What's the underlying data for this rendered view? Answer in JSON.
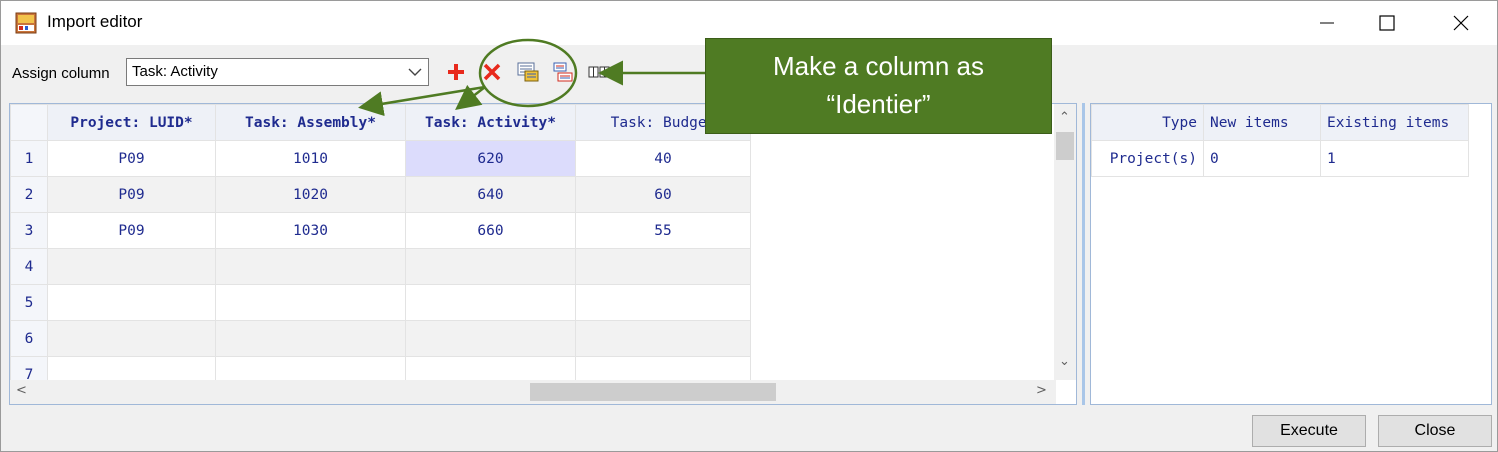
{
  "window": {
    "title": "Import editor",
    "app_icon": "mspo-app-icon"
  },
  "assign": {
    "label": "Assign column",
    "selected": "Task: Activity"
  },
  "toolbar": {
    "icons": [
      "add-column-icon",
      "delete-column-icon",
      "identifier-icon",
      "mapping-icon",
      "split-columns-icon"
    ],
    "colors": {
      "add": "#e8291c",
      "delete": "#e8291c"
    }
  },
  "callout": {
    "line1": "Make a column as",
    "line2": "“Identier”",
    "color": "#4f7b23"
  },
  "grid": {
    "headers": [
      "Project: LUID*",
      "Task: Assembly*",
      "Task: Activity*",
      "Task: Budget"
    ],
    "rows": [
      {
        "num": "1",
        "cells": [
          "P09",
          "1010",
          "620",
          "40"
        ]
      },
      {
        "num": "2",
        "cells": [
          "P09",
          "1020",
          "640",
          "60"
        ]
      },
      {
        "num": "3",
        "cells": [
          "P09",
          "1030",
          "660",
          "55"
        ]
      },
      {
        "num": "4",
        "cells": [
          "",
          "",
          "",
          ""
        ]
      },
      {
        "num": "5",
        "cells": [
          "",
          "",
          "",
          ""
        ]
      },
      {
        "num": "6",
        "cells": [
          "",
          "",
          "",
          ""
        ]
      },
      {
        "num": "7",
        "cells": [
          "",
          "",
          "",
          ""
        ]
      }
    ]
  },
  "summary": {
    "headers": [
      "Type",
      "New items",
      "Existing items"
    ],
    "rows": [
      {
        "type": "Project(s)",
        "new": "0",
        "existing": "1"
      }
    ]
  },
  "buttons": {
    "execute": "Execute",
    "close": "Close"
  }
}
